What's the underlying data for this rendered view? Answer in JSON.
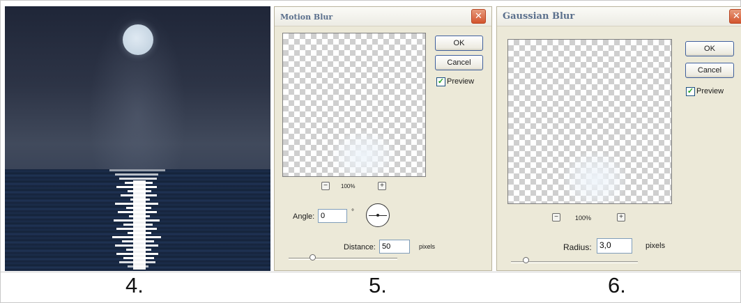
{
  "steps": {
    "step_4": "4.",
    "step_5": "5.",
    "step_6": "6."
  },
  "motion_blur": {
    "title": "Motion Blur",
    "ok_label": "OK",
    "cancel_label": "Cancel",
    "preview_label": "Preview",
    "preview_checked": true,
    "zoom": "100%",
    "angle_label": "Angle:",
    "angle_value": "0",
    "angle_unit": "°",
    "distance_label": "Distance:",
    "distance_value": "50",
    "distance_unit": "pixels",
    "distance_slider_level": 0.22
  },
  "gaussian_blur": {
    "title": "Gaussian Blur",
    "ok_label": "OK",
    "cancel_label": "Cancel",
    "preview_label": "Preview",
    "preview_checked": true,
    "zoom": "100%",
    "radius_label": "Radius:",
    "radius_value": "3,0",
    "radius_unit": "pixels",
    "radius_slider_level": 0.12
  },
  "icons": {
    "close": "close-icon",
    "zoom_out": "zoom-out-icon",
    "zoom_in": "zoom-in-icon",
    "check": "checkmark-icon",
    "angle_dial": "angle-dial-icon"
  },
  "colors": {
    "dialog_bg": "#ece9d8",
    "title_text": "#5a6f8c",
    "close_button": "#d3542d",
    "night_sky": "#2d3446",
    "sea": "#16243c",
    "moon": "#c6d5e2"
  }
}
